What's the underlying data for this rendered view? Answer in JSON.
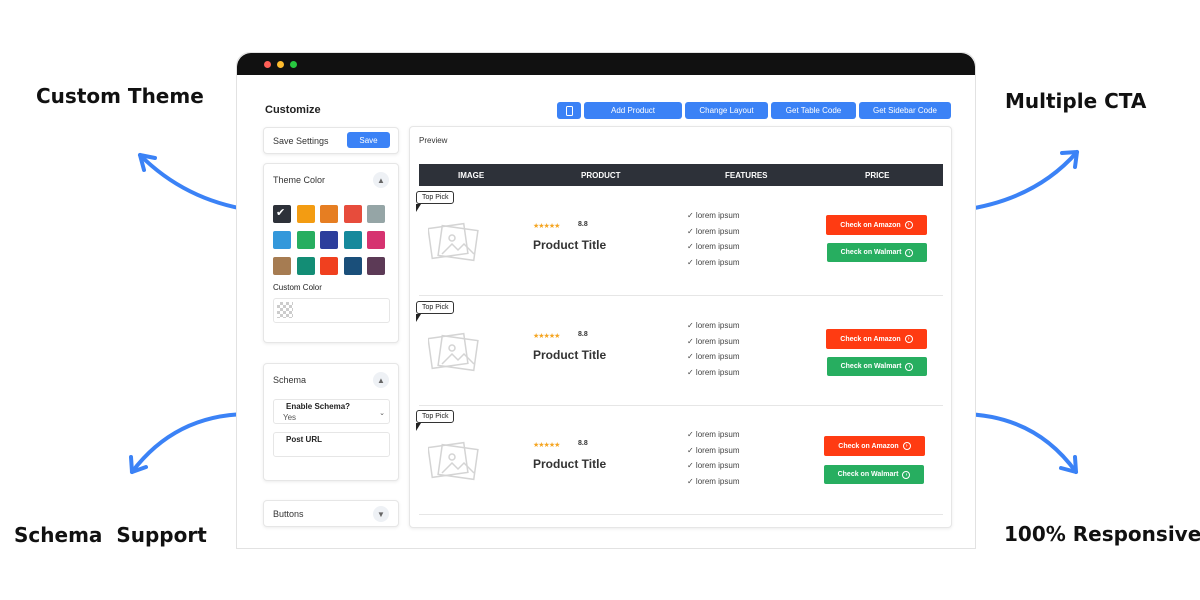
{
  "features": {
    "custom_theme": "Custom Theme",
    "multiple_cta": "Multiple CTA",
    "schema_support": "Schema  Support",
    "responsive": "100% Responsive"
  },
  "app": {
    "title": "Customize",
    "toolbar": {
      "mobile_icon": "mobile-icon",
      "add_product": "Add Product",
      "change_layout": "Change Layout",
      "get_table_code": "Get Table Code",
      "get_sidebar_code": "Get Sidebar Code"
    }
  },
  "sidebar": {
    "save_settings_label": "Save Settings",
    "save_button": "Save",
    "theme_color_title": "Theme Color",
    "colors": [
      "#2d3139",
      "#f39c12",
      "#e67e22",
      "#e74c3c",
      "#95a5a6",
      "#3498db",
      "#27ae60",
      "#2c3e9c",
      "#16899c",
      "#d63370",
      "#a67c52",
      "#138d75",
      "#f0401f",
      "#1a4f7a",
      "#5c3a56"
    ],
    "selected_color_index": 0,
    "custom_color_label": "Custom Color",
    "schema_title": "Schema",
    "enable_schema_label": "Enable Schema?",
    "enable_schema_value": "Yes",
    "post_url_label": "Post URL",
    "buttons_title": "Buttons"
  },
  "preview": {
    "title": "Preview",
    "columns": [
      "IMAGE",
      "PRODUCT",
      "FEATURES",
      "PRICE"
    ],
    "rows": [
      {
        "badge": "Top Pick",
        "rating": "8.8",
        "stars": "★★★★★",
        "title": "Product Title",
        "features": [
          "✓ lorem ipsum",
          "✓ lorem ipsum",
          "✓ lorem ipsum",
          "✓ lorem ipsum"
        ],
        "cta1": "Check on Amazon",
        "cta2": "Check on Walmart"
      },
      {
        "badge": "Top Pick",
        "rating": "8.8",
        "stars": "★★★★★",
        "title": "Product Title",
        "features": [
          "✓ lorem ipsum",
          "✓ lorem ipsum",
          "✓ lorem ipsum",
          "✓ lorem ipsum"
        ],
        "cta1": "Check on Amazon",
        "cta2": "Check on Walmart"
      },
      {
        "badge": "Top Pick",
        "rating": "8.8",
        "stars": "★★★★★",
        "title": "Product Title",
        "features": [
          "✓ lorem ipsum",
          "✓ lorem ipsum",
          "✓ lorem ipsum",
          "✓ lorem ipsum"
        ],
        "cta1": "Check on Amazon",
        "cta2": "Check on Walmart"
      }
    ]
  },
  "colors": {
    "accent_blue": "#3b82f6",
    "amazon_red": "#ff3b12",
    "walmart_green": "#27ae60",
    "table_header": "#2d3139",
    "arrow_blue": "#3b82f6"
  }
}
